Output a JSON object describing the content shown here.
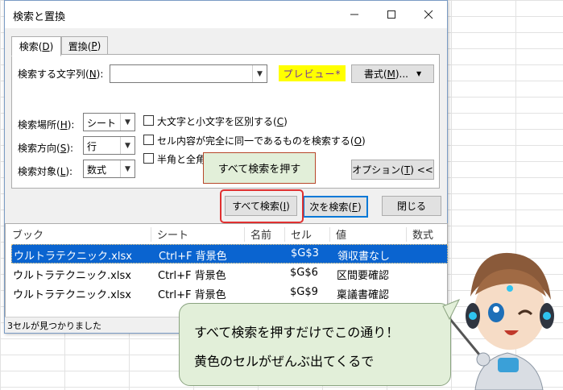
{
  "window": {
    "title": "検索と置換",
    "minimize_icon": "minimize-icon",
    "maximize_icon": "maximize-icon",
    "close_icon": "close-icon"
  },
  "tabs": [
    {
      "label": "検索(",
      "key": "D",
      "suffix": ")"
    },
    {
      "label": "置換(",
      "key": "P",
      "suffix": ")"
    }
  ],
  "search": {
    "label": "検索する文字列(",
    "key": "N",
    "suffix": "):",
    "value": "",
    "preview_label": "プレビュー*",
    "format_button": "書式(",
    "format_key": "M",
    "format_suffix": ")..."
  },
  "options": {
    "within": {
      "label": "検索場所(",
      "key": "H",
      "suffix": "):",
      "value": "シート"
    },
    "direction": {
      "label": "検索方向(",
      "key": "S",
      "suffix": "):",
      "value": "行"
    },
    "look_in": {
      "label": "検索対象(",
      "key": "L",
      "suffix": "):",
      "value": "数式"
    },
    "match_case": {
      "label": "大文字と小文字を区別する(",
      "key": "C",
      "suffix": ")"
    },
    "match_entire": {
      "label": "セル内容が完全に同一であるものを検索する(",
      "key": "O",
      "suffix": ")"
    },
    "match_width": {
      "label": "半角と全角を"
    },
    "options_button": "オプション(",
    "options_key": "T",
    "options_suffix": ") <<"
  },
  "buttons": {
    "find_all": {
      "label": "すべて検索(",
      "key": "I",
      "suffix": ")"
    },
    "find_next": {
      "label": "次を検索(",
      "key": "F",
      "suffix": ")"
    },
    "close": "閉じる"
  },
  "results": {
    "columns": [
      "ブック",
      "シート",
      "名前",
      "セル",
      "値",
      "数式"
    ],
    "rows": [
      {
        "book": "ウルトラテクニック.xlsx",
        "sheet": "Ctrl+F 背景色",
        "name": "",
        "cell": "$G$3",
        "value": "領収書なし",
        "formula": "",
        "selected": true
      },
      {
        "book": "ウルトラテクニック.xlsx",
        "sheet": "Ctrl+F 背景色",
        "name": "",
        "cell": "$G$6",
        "value": "区間要確認",
        "formula": ""
      },
      {
        "book": "ウルトラテクニック.xlsx",
        "sheet": "Ctrl+F 背景色",
        "name": "",
        "cell": "$G$9",
        "value": "稟議書確認",
        "formula": ""
      }
    ],
    "status": "3セルが見つかりました"
  },
  "annotations": {
    "callout_small": "すべて検索を押す",
    "callout_big_line1": "すべて検索を押すだけでこの通り！",
    "callout_big_line2": "黄色のセルがぜんぶ出てくるで"
  },
  "colors": {
    "selection": "#0a64d0",
    "preview_bg": "#ffff00",
    "callout_bg": "#e2efd9",
    "highlight_border": "#e03030"
  }
}
